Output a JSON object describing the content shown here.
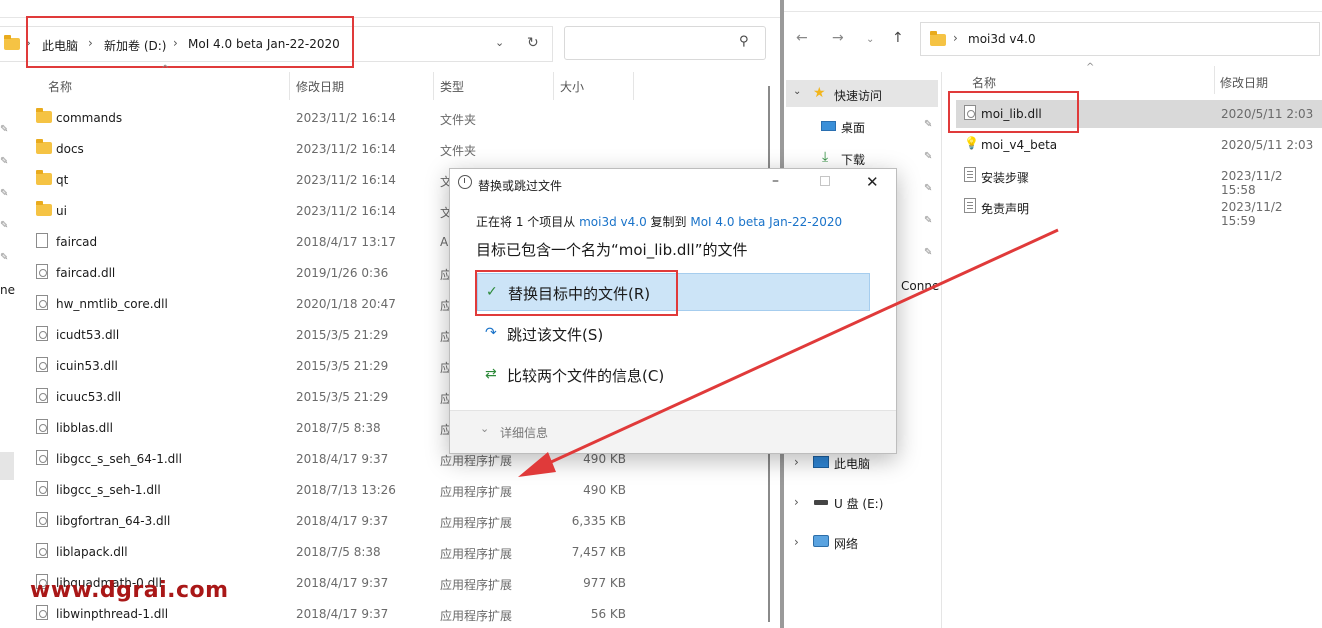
{
  "left": {
    "breadcrumb": [
      "此电脑",
      "新加卷 (D:)",
      "MoI 4.0 beta Jan-22-2020"
    ],
    "columns": {
      "name": "名称",
      "date": "修改日期",
      "type": "类型",
      "size": "大小"
    },
    "side_fragments": {
      "conne": "ne"
    },
    "rows": [
      {
        "icon": "folder",
        "name": "commands",
        "date": "2023/11/2 16:14",
        "type": "文件夹",
        "size": ""
      },
      {
        "icon": "folder",
        "name": "docs",
        "date": "2023/11/2 16:14",
        "type": "文件夹",
        "size": ""
      },
      {
        "icon": "folder",
        "name": "qt",
        "date": "2023/11/2 16:14",
        "type": "文",
        "size": ""
      },
      {
        "icon": "folder",
        "name": "ui",
        "date": "2023/11/2 16:14",
        "type": "文",
        "size": ""
      },
      {
        "icon": "file",
        "name": "faircad",
        "date": "2018/4/17 13:17",
        "type": "A",
        "size": ""
      },
      {
        "icon": "dll",
        "name": "faircad.dll",
        "date": "2019/1/26 0:36",
        "type": "应",
        "size": ""
      },
      {
        "icon": "dll",
        "name": "hw_nmtlib_core.dll",
        "date": "2020/1/18 20:47",
        "type": "应",
        "size": ""
      },
      {
        "icon": "dll",
        "name": "icudt53.dll",
        "date": "2015/3/5 21:29",
        "type": "应",
        "size": ""
      },
      {
        "icon": "dll",
        "name": "icuin53.dll",
        "date": "2015/3/5 21:29",
        "type": "应",
        "size": ""
      },
      {
        "icon": "dll",
        "name": "icuuc53.dll",
        "date": "2015/3/5 21:29",
        "type": "应",
        "size": ""
      },
      {
        "icon": "dll",
        "name": "libblas.dll",
        "date": "2018/7/5 8:38",
        "type": "应",
        "size": ""
      },
      {
        "icon": "dll",
        "name": "libgcc_s_seh_64-1.dll",
        "date": "2018/4/17 9:37",
        "type": "应用程序扩展",
        "size": "490 KB"
      },
      {
        "icon": "dll",
        "name": "libgcc_s_seh-1.dll",
        "date": "2018/7/13 13:26",
        "type": "应用程序扩展",
        "size": "490 KB"
      },
      {
        "icon": "dll",
        "name": "libgfortran_64-3.dll",
        "date": "2018/4/17 9:37",
        "type": "应用程序扩展",
        "size": "6,335 KB"
      },
      {
        "icon": "dll",
        "name": "liblapack.dll",
        "date": "2018/7/5 8:38",
        "type": "应用程序扩展",
        "size": "7,457 KB"
      },
      {
        "icon": "dll",
        "name": "libquadmath-0.dll",
        "date": "2018/4/17 9:37",
        "type": "应用程序扩展",
        "size": "977 KB"
      },
      {
        "icon": "dll",
        "name": "libwinpthread-1.dll",
        "date": "2018/4/17 9:37",
        "type": "应用程序扩展",
        "size": "56 KB"
      }
    ]
  },
  "right": {
    "breadcrumb": "moi3d v4.0",
    "columns": {
      "name": "名称",
      "date": "修改日期"
    },
    "nav": {
      "quick_access": "快速访问",
      "desktop": "桌面",
      "downloads": "下载",
      "conne": "Conne",
      "this_pc": "此电脑",
      "usb": "U 盘 (E:)",
      "network": "网络"
    },
    "rows": [
      {
        "icon": "dll",
        "name": "moi_lib.dll",
        "date": "2020/5/11 2:03"
      },
      {
        "icon": "bulb",
        "name": "moi_v4_beta",
        "date": "2020/5/11 2:03"
      },
      {
        "icon": "txt",
        "name": "安装步骤",
        "date": "2023/11/2 15:58"
      },
      {
        "icon": "txt",
        "name": "免责声明",
        "date": "2023/11/2 15:59"
      }
    ]
  },
  "dialog": {
    "title": "替换或跳过文件",
    "copy_line": {
      "prefix": "正在将 1 个项目从 ",
      "source": "moi3d v4.0",
      "middle": " 复制到 ",
      "dest": "MoI 4.0 beta Jan-22-2020"
    },
    "message": "目标已包含一个名为“moi_lib.dll”的文件",
    "options": {
      "replace": "替换目标中的文件(R)",
      "skip": "跳过该文件(S)",
      "compare": "比较两个文件的信息(C)"
    },
    "details": "详细信息"
  },
  "watermark": "www.dgrai.com",
  "colors": {
    "accent": "#1a73c9",
    "highlight": "#cce4f7",
    "annotation": "#e03a3a"
  }
}
